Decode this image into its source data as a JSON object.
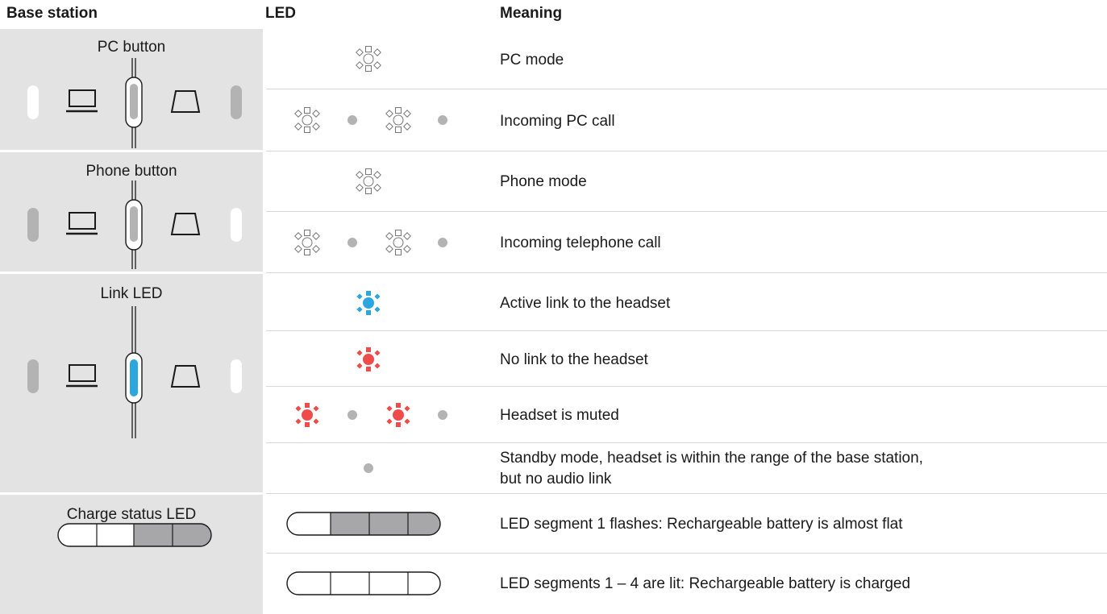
{
  "header": {
    "base_station": "Base station",
    "led": "LED",
    "meaning": "Meaning"
  },
  "sections": {
    "pc": {
      "title": "PC button",
      "active_led": "left-white"
    },
    "phone": {
      "title": "Phone button",
      "active_led": "right-white"
    },
    "link": {
      "title": "Link LED",
      "active_led": "center-blue"
    },
    "charge": {
      "title": "Charge status LED",
      "segments_lit": [
        true,
        true,
        false,
        false
      ]
    }
  },
  "rows": [
    {
      "pattern": "steady",
      "color": "white",
      "meaning": "PC mode"
    },
    {
      "pattern": "flash",
      "color": "white",
      "meaning": "Incoming PC call"
    },
    {
      "pattern": "steady",
      "color": "white",
      "meaning": "Phone mode"
    },
    {
      "pattern": "flash",
      "color": "white",
      "meaning": "Incoming telephone call"
    },
    {
      "pattern": "steady",
      "color": "blue",
      "meaning": "Active link to the headset"
    },
    {
      "pattern": "steady",
      "color": "red",
      "meaning": "No link to the headset"
    },
    {
      "pattern": "flash",
      "color": "red",
      "meaning": "Headset is muted"
    },
    {
      "pattern": "off",
      "color": "grey",
      "meaning_line1": "Standby mode, headset is within the range of the base station,",
      "meaning_line2": "but no audio link"
    },
    {
      "pattern": "battery",
      "segments_lit": [
        true,
        false,
        false,
        false
      ],
      "meaning": "LED segment 1 flashes: Rechargeable battery is almost flat"
    },
    {
      "pattern": "battery",
      "segments_lit": [
        true,
        true,
        true,
        true
      ],
      "meaning": "LED segments 1 – 4 are lit: Rechargeable battery is charged"
    }
  ],
  "colors": {
    "panel_grey": "#e3e3e3",
    "led_grey": "#b3b3b3",
    "led_blue": "#2ba6de",
    "led_red": "#ef4b4b",
    "segment_grey": "#a7a7a9"
  }
}
